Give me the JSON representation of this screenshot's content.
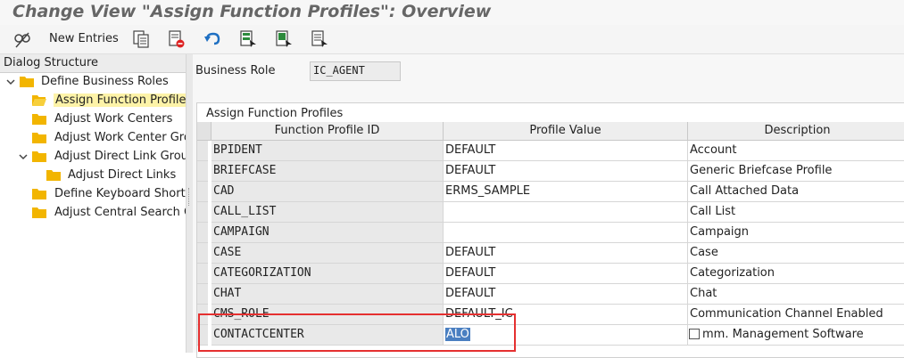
{
  "title": "Change View \"Assign Function Profiles\": Overview",
  "toolbar": {
    "new_entries": "New Entries",
    "icons": [
      "glasses-pencil-icon",
      "copy-icon",
      "delete-icon",
      "undo-icon",
      "select-all-icon",
      "select-block-icon",
      "deselect-all-icon"
    ]
  },
  "dialog_structure": {
    "title": "Dialog Structure",
    "items": [
      {
        "label": "Define Business Roles",
        "level": 0,
        "expanded": true
      },
      {
        "label": "Assign Function Profiles",
        "level": 1,
        "selected": true
      },
      {
        "label": "Adjust Work Centers",
        "level": 1
      },
      {
        "label": "Adjust Work Center Gro",
        "level": 1
      },
      {
        "label": "Adjust Direct Link Group",
        "level": 1,
        "expanded": true
      },
      {
        "label": "Adjust Direct Links",
        "level": 2
      },
      {
        "label": "Define Keyboard Shortc",
        "level": 1
      },
      {
        "label": "Adjust Central Search C",
        "level": 1
      }
    ]
  },
  "business_role": {
    "label": "Business Role",
    "value": "IC_AGENT"
  },
  "table": {
    "title": "Assign Function Profiles",
    "columns": [
      "Function Profile ID",
      "Profile Value",
      "Description"
    ],
    "rows": [
      {
        "id": "BPIDENT",
        "value": "DEFAULT",
        "desc": "Account"
      },
      {
        "id": "BRIEFCASE",
        "value": "DEFAULT",
        "desc": "Generic Briefcase Profile"
      },
      {
        "id": "CAD",
        "value": "ERMS_SAMPLE",
        "desc": "Call Attached Data"
      },
      {
        "id": "CALL_LIST",
        "value": "",
        "desc": "Call List"
      },
      {
        "id": "CAMPAIGN",
        "value": "",
        "desc": "Campaign"
      },
      {
        "id": "CASE",
        "value": "DEFAULT",
        "desc": "Case"
      },
      {
        "id": "CATEGORIZATION",
        "value": "DEFAULT",
        "desc": "Categorization"
      },
      {
        "id": "CHAT",
        "value": "DEFAULT",
        "desc": "Chat"
      },
      {
        "id": "CMS_ROLE",
        "value": "DEFAULT_IC",
        "desc": "Communication Channel Enabled"
      },
      {
        "id": "CONTACTCENTER",
        "value": "ALO",
        "desc": "mm. Management Software"
      }
    ]
  },
  "highlight_color": "#e53030"
}
